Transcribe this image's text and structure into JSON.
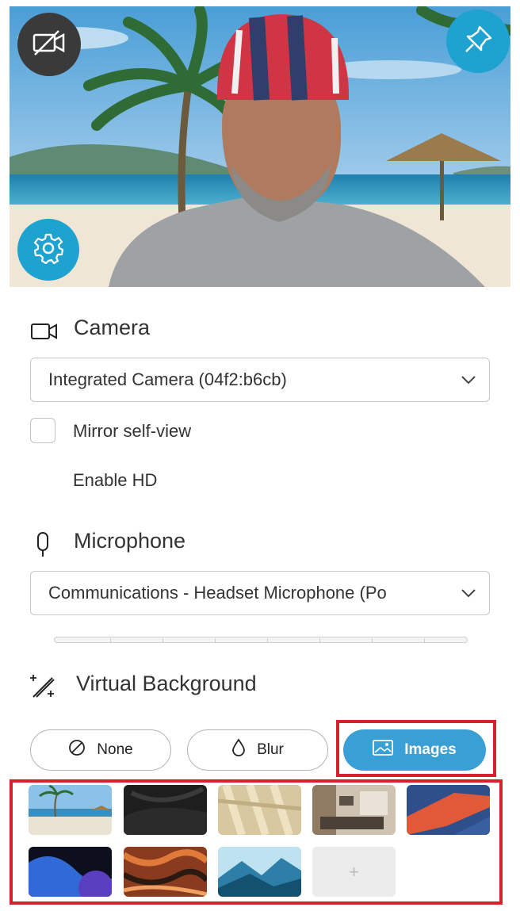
{
  "preview": {
    "camera_off_icon": "video-off-icon",
    "pin_icon": "pin-icon",
    "settings_icon": "gear-icon"
  },
  "camera": {
    "title": "Camera",
    "icon": "video-camera-icon",
    "selected_device": "Integrated Camera (04f2:b6cb)",
    "options": {
      "mirror_label": "Mirror self-view",
      "mirror_checked": false,
      "hd_label": "Enable HD"
    }
  },
  "microphone": {
    "title": "Microphone",
    "icon": "microphone-icon",
    "selected_device": "Communications - Headset Microphone (Po",
    "level": 0
  },
  "virtual_background": {
    "title": "Virtual Background",
    "icon": "magic-wand-icon",
    "buttons": [
      {
        "label": "None",
        "icon": "no-symbol-icon",
        "selected": false
      },
      {
        "label": "Blur",
        "icon": "droplet-icon",
        "selected": false
      },
      {
        "label": "Images",
        "icon": "image-icon",
        "selected": true
      }
    ],
    "images": [
      "beach",
      "dark-abstract",
      "sunlit-wall",
      "living-room",
      "red-blue-geometric",
      "blue-purple-abstract",
      "orange-marble",
      "blue-mountains"
    ],
    "add_label": "+"
  },
  "colors": {
    "accent": "#1ea2cf",
    "active_button": "#3a9fd4",
    "highlight": "#d3232c"
  }
}
